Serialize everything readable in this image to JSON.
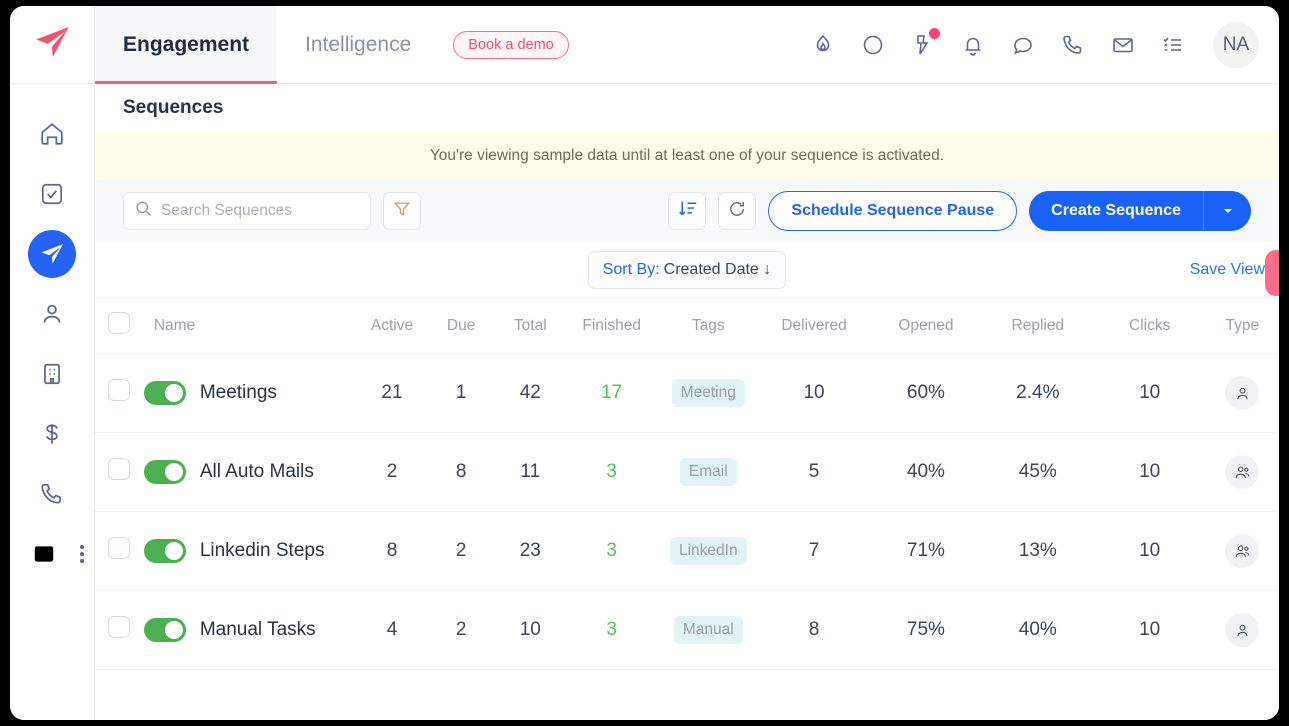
{
  "window": {
    "title": "Sequences"
  },
  "sidebar": {
    "logo_icon": "paper-plane-logo",
    "items": [
      {
        "icon": "home-icon",
        "name": "home"
      },
      {
        "icon": "task-check-icon",
        "name": "tasks"
      },
      {
        "icon": "send-plane-icon",
        "name": "sequences",
        "active": true
      },
      {
        "icon": "person-icon",
        "name": "contacts"
      },
      {
        "icon": "building-icon",
        "name": "accounts"
      },
      {
        "icon": "dollar-icon",
        "name": "deals"
      },
      {
        "icon": "phone-icon",
        "name": "calls"
      },
      {
        "icon": "table-icon",
        "name": "reports"
      }
    ]
  },
  "topbar": {
    "tabs": [
      {
        "label": "Engagement",
        "active": true
      },
      {
        "label": "Intelligence",
        "active": false
      }
    ],
    "demo_label": "Book a demo",
    "icons": [
      "flame-icon",
      "circle-icon",
      "lightning-bolt-icon",
      "bell-icon",
      "chat-bubble-icon",
      "phone-icon",
      "mail-icon",
      "checklist-icon"
    ],
    "avatar_initials": "NA"
  },
  "banner": {
    "message": "You're viewing sample data until at least one of your sequence is activated."
  },
  "toolbar": {
    "search_placeholder": "Search Sequences",
    "search_value": "",
    "filter_icon": "funnel-icon",
    "sort_icon": "sort-descending-icon",
    "refresh_icon": "refresh-icon",
    "schedule_pause_label": "Schedule Sequence Pause",
    "create_label": "Create Sequence",
    "create_caret_icon": "chevron-down-icon"
  },
  "sortrow": {
    "sort_prefix": "Sort By:",
    "sort_value": "Created Date ↓",
    "save_view_label": "Save View"
  },
  "table": {
    "columns": [
      "Name",
      "Active",
      "Due",
      "Total",
      "Finished",
      "Tags",
      "Delivered",
      "Opened",
      "Replied",
      "Clicks",
      "Type"
    ],
    "rows": [
      {
        "enabled": true,
        "name": "Meetings",
        "active": "21",
        "due": "1",
        "total": "42",
        "finished": "17",
        "tag": "Meeting",
        "delivered": "10",
        "opened": "60%",
        "replied": "2.4%",
        "clicks": "10",
        "type_icon": "single-person-icon"
      },
      {
        "enabled": true,
        "name": "All Auto Mails",
        "active": "2",
        "due": "8",
        "total": "11",
        "finished": "3",
        "tag": "Email",
        "delivered": "5",
        "opened": "40%",
        "replied": "45%",
        "clicks": "10",
        "type_icon": "multi-person-icon"
      },
      {
        "enabled": true,
        "name": "Linkedin Steps",
        "active": "8",
        "due": "2",
        "total": "23",
        "finished": "3",
        "tag": "LinkedIn",
        "delivered": "7",
        "opened": "71%",
        "replied": "13%",
        "clicks": "10",
        "type_icon": "multi-person-icon"
      },
      {
        "enabled": true,
        "name": "Manual Tasks",
        "active": "4",
        "due": "2",
        "total": "10",
        "finished": "3",
        "tag": "Manual",
        "delivered": "8",
        "opened": "75%",
        "replied": "40%",
        "clicks": "10",
        "type_icon": "single-person-icon"
      }
    ]
  },
  "colors": {
    "primary_blue": "#1a62f5",
    "accent_pink": "#f3616e",
    "toggle_green": "#4caf50",
    "finished_green": "#5cc05c",
    "banner_yellow": "#fdfde8",
    "tag_blue": "#e2f3f6"
  }
}
